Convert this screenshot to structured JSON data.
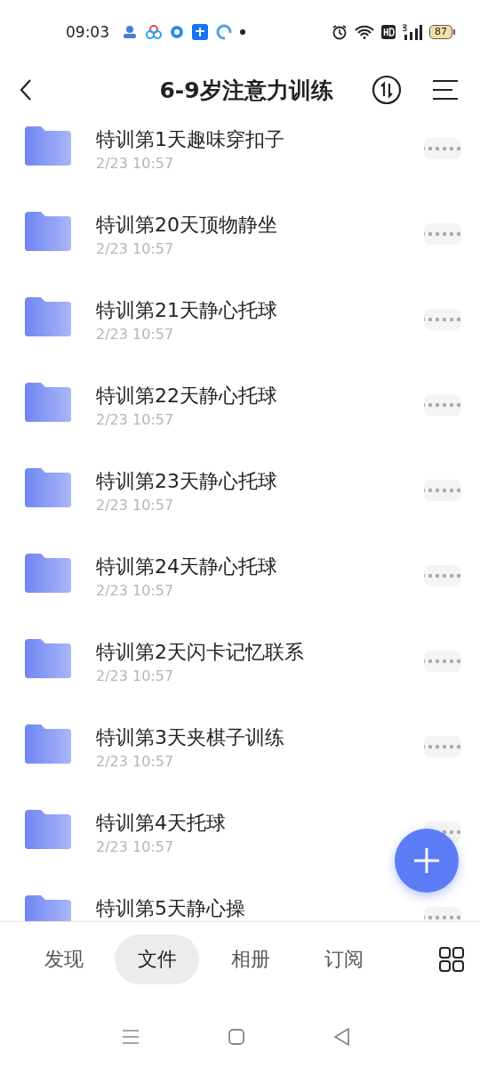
{
  "status_bar": {
    "time": "09:03",
    "battery": "87"
  },
  "header": {
    "title": "6-9岁注意力训练"
  },
  "folders": [
    {
      "name": "特训第1天趣味穿扣子",
      "date": "2/23 10:57"
    },
    {
      "name": "特训第20天顶物静坐",
      "date": "2/23 10:57"
    },
    {
      "name": "特训第21天静心托球",
      "date": "2/23 10:57"
    },
    {
      "name": "特训第22天静心托球",
      "date": "2/23 10:57"
    },
    {
      "name": "特训第23天静心托球",
      "date": "2/23 10:57"
    },
    {
      "name": "特训第24天静心托球",
      "date": "2/23 10:57"
    },
    {
      "name": "特训第2天闪卡记忆联系",
      "date": "2/23 10:57"
    },
    {
      "name": "特训第3天夹棋子训练",
      "date": "2/23 10:57"
    },
    {
      "name": "特训第4天托球",
      "date": "2/23 10:57"
    },
    {
      "name": "特训第5天静心操"
    }
  ],
  "tabs": [
    {
      "label": "发现",
      "selected": false
    },
    {
      "label": "文件",
      "selected": true
    },
    {
      "label": "相册",
      "selected": false
    },
    {
      "label": "订阅",
      "selected": false
    }
  ]
}
